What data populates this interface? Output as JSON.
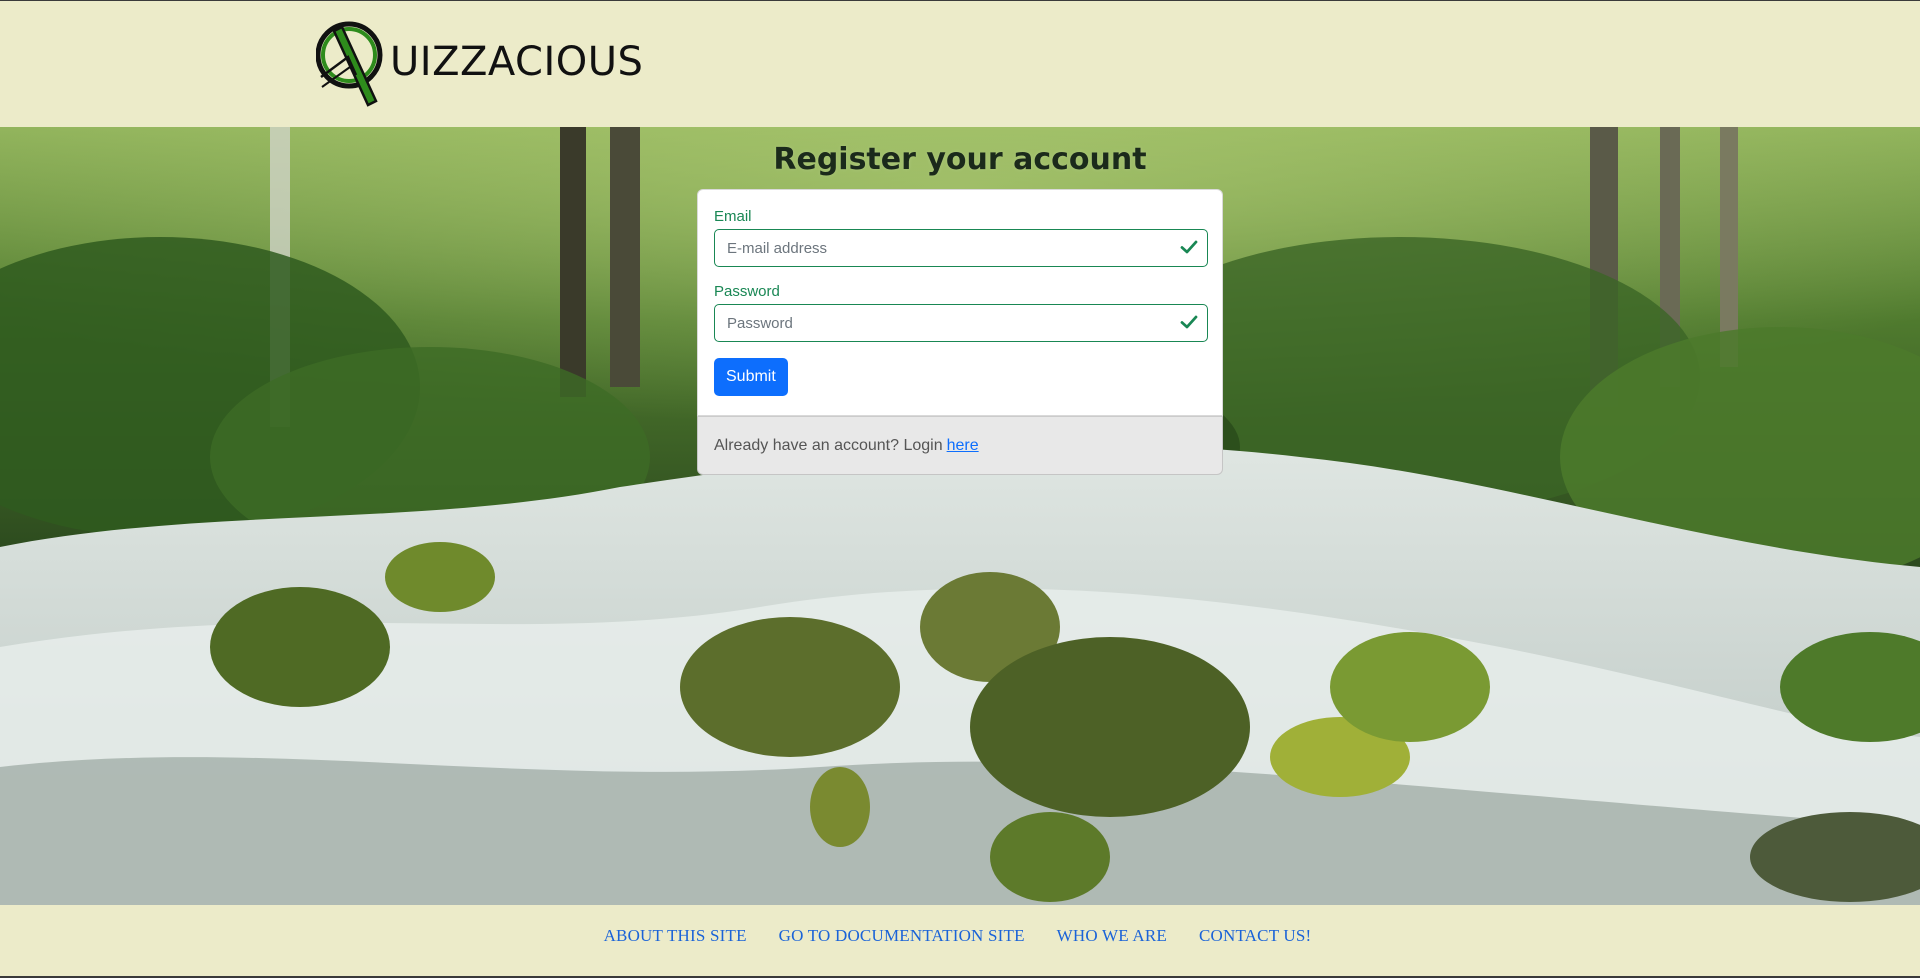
{
  "brand": {
    "logo_text": "UIZZACIOUS",
    "logo_mark_letter": "Q",
    "colors": {
      "logo_green": "#2e8b1c",
      "logo_dark": "#111111"
    }
  },
  "page": {
    "title": "Register your account"
  },
  "form": {
    "email": {
      "label": "Email",
      "placeholder": "E-mail address",
      "value": "",
      "state": "valid"
    },
    "password": {
      "label": "Password",
      "placeholder": "Password",
      "value": "",
      "state": "valid"
    },
    "submit_label": "Submit",
    "valid_color": "#198754",
    "button_color": "#0d6efd"
  },
  "login_prompt": {
    "text": "Already have an account? Login",
    "link_label": "here"
  },
  "footer": {
    "links": [
      {
        "label": "ABOUT THIS SITE"
      },
      {
        "label": "GO TO DOCUMENTATION SITE"
      },
      {
        "label": "WHO WE ARE"
      },
      {
        "label": "CONTACT US!"
      }
    ]
  },
  "theme": {
    "header_bg": "#ecebc9",
    "footer_bg": "#ecebc9"
  }
}
